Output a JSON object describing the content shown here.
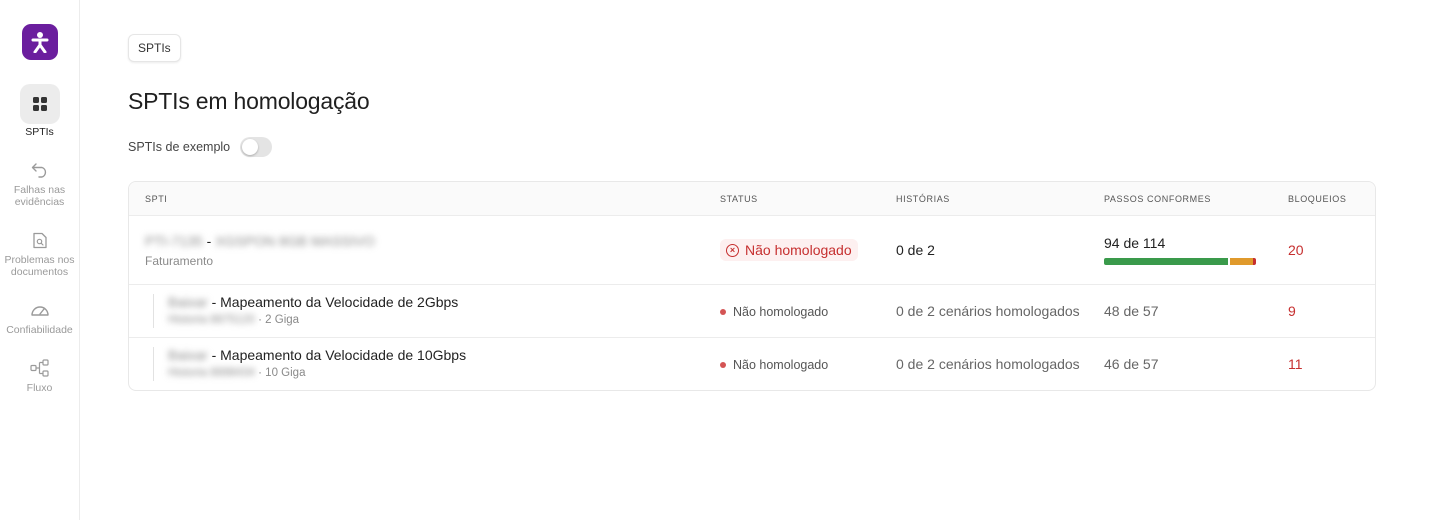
{
  "sidebar": {
    "logo": "accessibility-person-icon",
    "items": [
      {
        "label": "SPTIs",
        "icon": "grid-icon",
        "active": true
      },
      {
        "label": "Falhas nas evidências",
        "icon": "undo-arrow-icon",
        "active": false
      },
      {
        "label": "Problemas nos documentos",
        "icon": "document-search-icon",
        "active": false
      },
      {
        "label": "Confiabilidade",
        "icon": "gauge-icon",
        "active": false
      },
      {
        "label": "Fluxo",
        "icon": "flow-icon",
        "active": false
      }
    ]
  },
  "breadcrumb": "SPTIs",
  "page_title": "SPTIs em homologação",
  "toggle": {
    "label": "SPTIs de exemplo",
    "on": false
  },
  "table": {
    "headers": [
      "SPTI",
      "STATUS",
      "HISTÓRIAS",
      "PASSOS CONFORMES",
      "BLOQUEIOS"
    ],
    "parent": {
      "code_redacted": "PTI-7135",
      "separator": "-",
      "name_redacted": "XGSPON 8GB MASSIVO",
      "subtitle": "Faturamento",
      "status": "Não homologado",
      "historias": "0 de 2",
      "passos": "94 de 114",
      "passos_conformes": 94,
      "passos_total": 114,
      "bloqueios": "20"
    },
    "children": [
      {
        "name_redacted": "Baixar",
        "title": "- Mapeamento da Velocidade de 2Gbps",
        "sub_redacted": "Historia 8875120",
        "sub_suffix": "· 2 Giga",
        "status": "Não homologado",
        "historias": "0 de 2 cenários homologados",
        "passos": "48 de 57",
        "bloqueios": "9"
      },
      {
        "name_redacted": "Baixar",
        "title": "- Mapeamento da Velocidade de 10Gbps",
        "sub_redacted": "Historia 8898434",
        "sub_suffix": "· 10 Giga",
        "status": "Não homologado",
        "historias": "0 de 2 cenários homologados",
        "passos": "46 de 57",
        "bloqueios": "11"
      }
    ]
  },
  "colors": {
    "brand": "#6b1e9e",
    "error": "#c62f2f",
    "bar_green": "#3a9a4b",
    "bar_orange": "#e09a2c"
  }
}
